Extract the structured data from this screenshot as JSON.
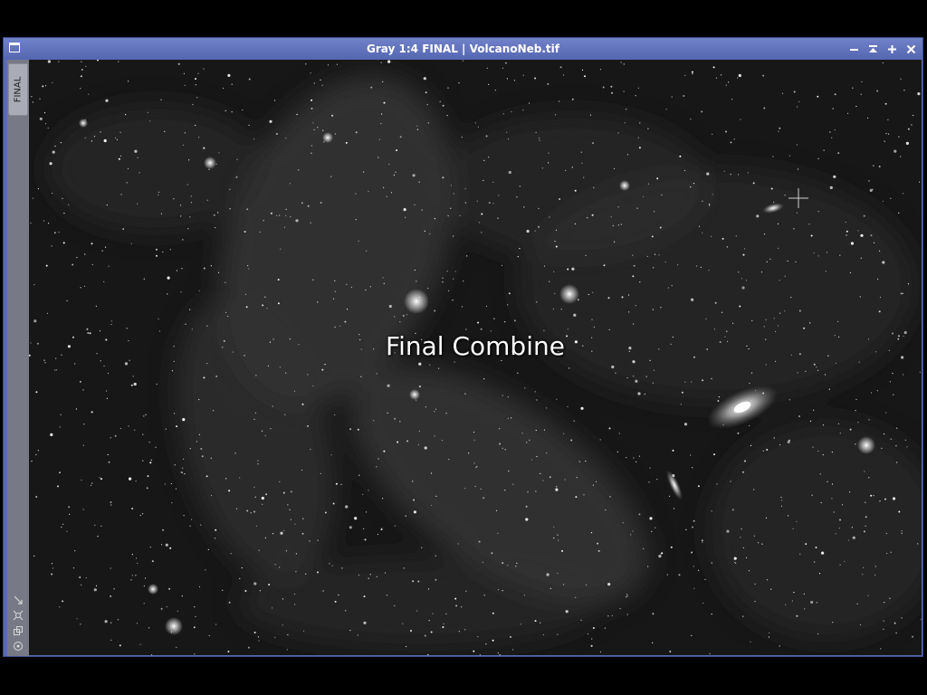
{
  "window": {
    "title": "Gray 1:4 FINAL | VolcanoNeb.tif",
    "view_tab": "FINAL",
    "controls": [
      "minimize-icon",
      "shade-icon",
      "maximize-icon",
      "close-icon"
    ],
    "accent_color": "#5a6cae"
  },
  "image": {
    "caption": "Final Combine",
    "tools": [
      "arrow-icon",
      "crosshair-icon",
      "clone-icon",
      "target-icon"
    ]
  }
}
